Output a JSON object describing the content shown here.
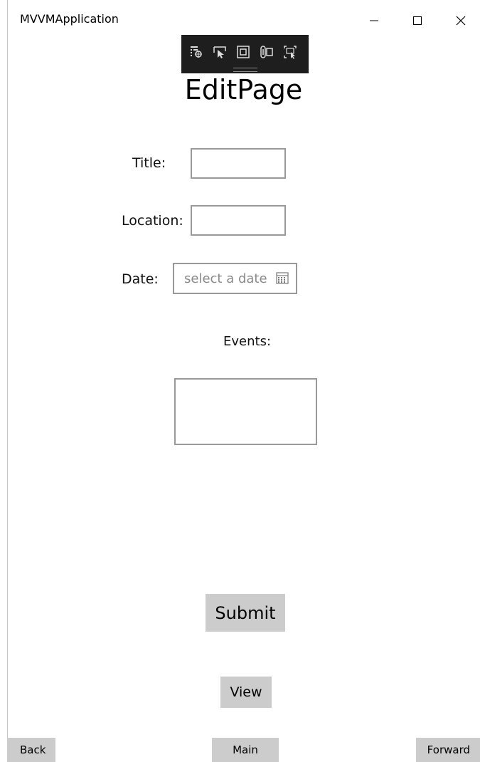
{
  "window": {
    "title": "MVVMApplication",
    "minimize_glyph": "minimize-icon",
    "maximize_glyph": "maximize-icon",
    "close_glyph": "close-icon"
  },
  "debug_toolbar": {
    "icons": [
      "live-visual-tree-icon",
      "select-element-icon",
      "display-layout-adorners-icon",
      "track-focused-element-icon",
      "preview-selection-icon"
    ]
  },
  "page": {
    "heading": "EditPage",
    "form": {
      "title_label": "Title:",
      "title_value": "",
      "location_label": "Location:",
      "location_value": "",
      "date_label": "Date:",
      "date_placeholder": "select a date",
      "events_label": "Events:",
      "events_value": ""
    },
    "submit_label": "Submit",
    "view_label": "View"
  },
  "nav": {
    "back_label": "Back",
    "main_label": "Main",
    "forward_label": "Forward"
  },
  "colors": {
    "button_bg": "#cccccc",
    "field_border": "#999999",
    "toolbar_bg": "#1e1e1e"
  }
}
